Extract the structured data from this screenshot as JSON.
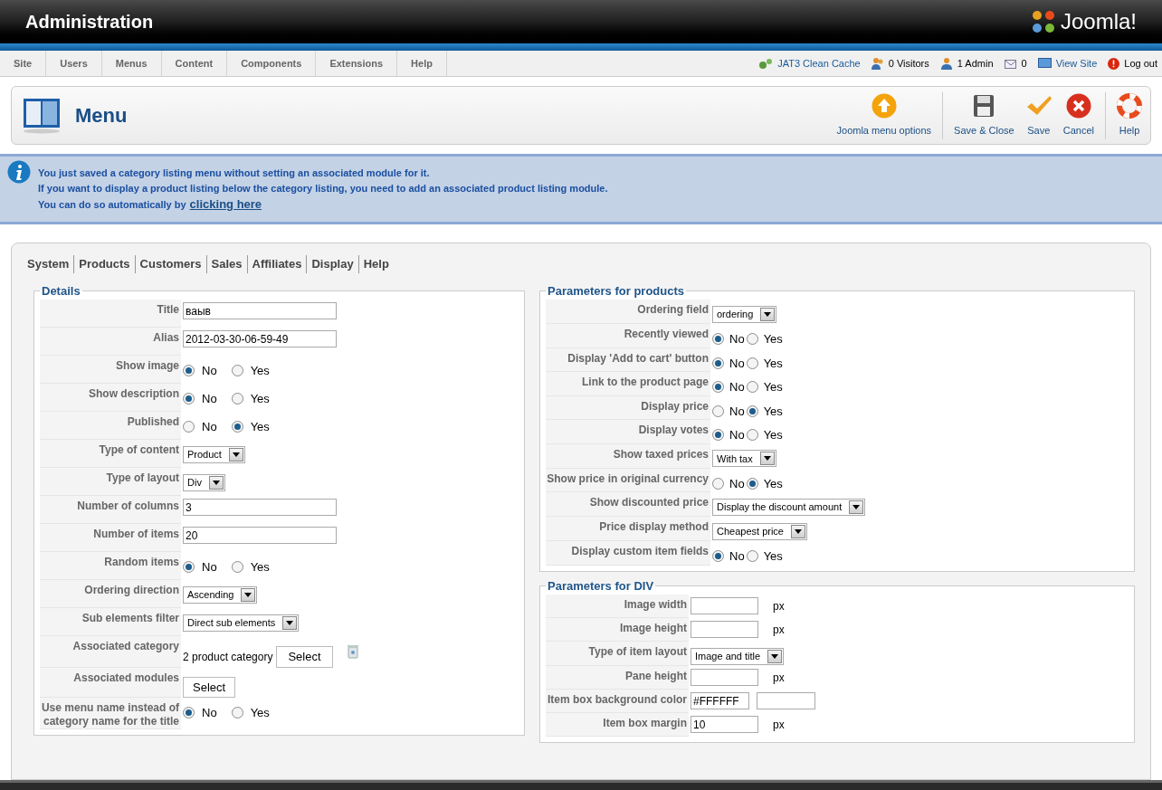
{
  "header": {
    "title": "Administration",
    "logo_text": "Joomla!"
  },
  "menu": [
    "Site",
    "Users",
    "Menus",
    "Content",
    "Components",
    "Extensions",
    "Help"
  ],
  "status": [
    {
      "kind": "cache",
      "label": "JAT3 Clean Cache",
      "link": true
    },
    {
      "kind": "visitors",
      "label": "0 Visitors",
      "link": false
    },
    {
      "kind": "admin",
      "label": "1 Admin",
      "link": false
    },
    {
      "kind": "messages",
      "label": "0",
      "link": false
    },
    {
      "kind": "view",
      "label": "View Site",
      "link": true
    },
    {
      "kind": "logout",
      "label": "Log out",
      "link": false
    }
  ],
  "page_title": "Menu",
  "toolbar": [
    {
      "kind": "options",
      "label": "Joomla menu options"
    },
    {
      "kind": "save-close",
      "label": "Save & Close"
    },
    {
      "kind": "save",
      "label": "Save"
    },
    {
      "kind": "cancel",
      "label": "Cancel"
    },
    {
      "kind": "help",
      "label": "Help"
    }
  ],
  "message": {
    "lines": [
      "You just saved a category listing menu without setting an associated module for it.",
      "If you want to display a product listing below the category listing, you need to add an associated product listing module.",
      "You can do so automatically by"
    ],
    "link": "clicking here"
  },
  "tabs": [
    "System",
    "Products",
    "Customers",
    "Sales",
    "Affiliates",
    "Display",
    "Help"
  ],
  "details": {
    "legend": "Details",
    "rows": [
      {
        "kind": "text",
        "label": "Title",
        "value": "ваыв"
      },
      {
        "kind": "text",
        "label": "Alias",
        "value": "2012-03-30-06-59-49"
      },
      {
        "kind": "radio",
        "label": "Show image",
        "options": [
          {
            "label": "No",
            "selected": true
          },
          {
            "label": "Yes",
            "selected": false
          }
        ]
      },
      {
        "kind": "radio",
        "label": "Show description",
        "options": [
          {
            "label": "No",
            "selected": true
          },
          {
            "label": "Yes",
            "selected": false
          }
        ]
      },
      {
        "kind": "radio",
        "label": "Published",
        "options": [
          {
            "label": "No",
            "selected": false
          },
          {
            "label": "Yes",
            "selected": true
          }
        ]
      },
      {
        "kind": "select",
        "label": "Type of content",
        "value": "Product"
      },
      {
        "kind": "select",
        "label": "Type of layout",
        "value": "Div"
      },
      {
        "kind": "text",
        "label": "Number of columns",
        "value": "3"
      },
      {
        "kind": "text",
        "label": "Number of items",
        "value": "20"
      },
      {
        "kind": "radio",
        "label": "Random items",
        "options": [
          {
            "label": "No",
            "selected": true
          },
          {
            "label": "Yes",
            "selected": false
          }
        ]
      },
      {
        "kind": "select",
        "label": "Ordering direction",
        "value": "Ascending"
      },
      {
        "kind": "select",
        "label": "Sub elements filter",
        "value": "Direct sub elements"
      },
      {
        "kind": "category",
        "label": "Associated category",
        "value": "2 product category",
        "button": "Select"
      },
      {
        "kind": "button",
        "label": "Associated modules",
        "button": "Select"
      },
      {
        "kind": "radio",
        "label": "Use menu name instead of category name for the title",
        "options": [
          {
            "label": "No",
            "selected": true
          },
          {
            "label": "Yes",
            "selected": false
          }
        ]
      }
    ]
  },
  "products": {
    "legend": "Parameters for products",
    "rows": [
      {
        "kind": "select",
        "label": "Ordering field",
        "value": "ordering"
      },
      {
        "kind": "radio",
        "label": "Recently viewed",
        "options": [
          {
            "label": "No",
            "selected": true
          },
          {
            "label": "Yes",
            "selected": false
          }
        ]
      },
      {
        "kind": "radio",
        "label": "Display 'Add to cart' button",
        "options": [
          {
            "label": "No",
            "selected": true
          },
          {
            "label": "Yes",
            "selected": false
          }
        ]
      },
      {
        "kind": "radio",
        "label": "Link to the product page",
        "options": [
          {
            "label": "No",
            "selected": true
          },
          {
            "label": "Yes",
            "selected": false
          }
        ]
      },
      {
        "kind": "radio",
        "label": "Display price",
        "options": [
          {
            "label": "No",
            "selected": false
          },
          {
            "label": "Yes",
            "selected": true
          }
        ]
      },
      {
        "kind": "radio",
        "label": "Display votes",
        "options": [
          {
            "label": "No",
            "selected": true
          },
          {
            "label": "Yes",
            "selected": false
          }
        ]
      },
      {
        "kind": "select",
        "label": "Show taxed prices",
        "value": "With tax"
      },
      {
        "kind": "radio",
        "label": "Show price in original currency",
        "options": [
          {
            "label": "No",
            "selected": false
          },
          {
            "label": "Yes",
            "selected": true
          }
        ]
      },
      {
        "kind": "select",
        "label": "Show discounted price",
        "value": "Display the discount amount"
      },
      {
        "kind": "select",
        "label": "Price display method",
        "value": "Cheapest price"
      },
      {
        "kind": "radio",
        "label": "Display custom item fields",
        "options": [
          {
            "label": "No",
            "selected": true
          },
          {
            "label": "Yes",
            "selected": false
          }
        ]
      }
    ]
  },
  "div": {
    "legend": "Parameters for DIV",
    "rows": [
      {
        "kind": "text",
        "label": "Image width",
        "unit": "px"
      },
      {
        "kind": "text",
        "label": "Image height",
        "unit": "px"
      },
      {
        "kind": "select",
        "label": "Type of item layout",
        "value": "Image and title"
      },
      {
        "kind": "text",
        "label": "Pane height",
        "unit": "px"
      },
      {
        "kind": "color",
        "label": "Item box background color",
        "value": "#FFFFFF"
      },
      {
        "kind": "text",
        "label": "Item box margin",
        "value": "10",
        "unit": "px"
      }
    ]
  }
}
